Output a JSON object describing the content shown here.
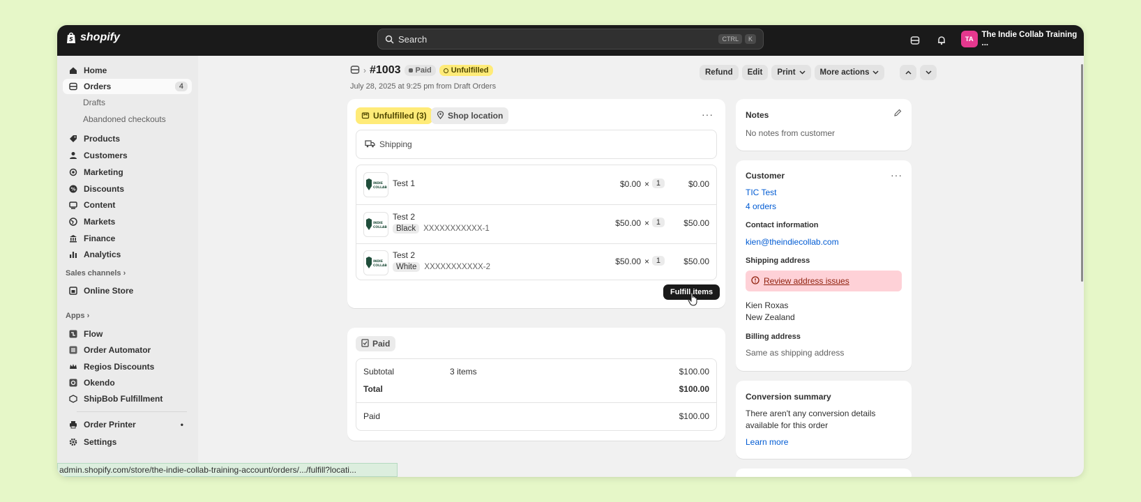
{
  "topbar": {
    "brand": "shopify",
    "search_placeholder": "Search",
    "shortcut_ctrl": "CTRL",
    "shortcut_k": "K",
    "avatar_initials": "TA",
    "store_name": "The Indie Collab Training ..."
  },
  "sidebar": {
    "home": "Home",
    "orders": "Orders",
    "orders_count": "4",
    "drafts": "Drafts",
    "abandoned": "Abandoned checkouts",
    "products": "Products",
    "customers": "Customers",
    "marketing": "Marketing",
    "discounts": "Discounts",
    "content": "Content",
    "markets": "Markets",
    "finance": "Finance",
    "analytics": "Analytics",
    "sales_channels": "Sales channels",
    "online_store": "Online Store",
    "apps": "Apps",
    "flow": "Flow",
    "order_automator": "Order Automator",
    "regios": "Regios Discounts",
    "okendo": "Okendo",
    "shipbob": "ShipBob Fulfillment",
    "order_printer": "Order Printer",
    "settings": "Settings"
  },
  "statusbar": {
    "url": "admin.shopify.com/store/the-indie-collab-training-account/orders/.../fulfill?locati..."
  },
  "order": {
    "number": "#1003",
    "payment_badge": "Paid",
    "fulfillment_badge": "Unfulfilled",
    "subtitle": "July 28, 2025 at 9:25 pm from Draft Orders",
    "actions": {
      "refund": "Refund",
      "edit": "Edit",
      "print": "Print",
      "more": "More actions"
    }
  },
  "fulfillment_card": {
    "status_chip": "Unfulfilled (3)",
    "location_chip": "Shop location",
    "shipping_label": "Shipping",
    "items": [
      {
        "name": "Test 1",
        "variant": "",
        "sku": "",
        "unit_price": "$0.00",
        "times": "×",
        "qty": "1",
        "total": "$0.00"
      },
      {
        "name": "Test 2",
        "variant": "Black",
        "sku": "XXXXXXXXXXX-1",
        "unit_price": "$50.00",
        "times": "×",
        "qty": "1",
        "total": "$50.00"
      },
      {
        "name": "Test 2",
        "variant": "White",
        "sku": "XXXXXXXXXXX-2",
        "unit_price": "$50.00",
        "times": "×",
        "qty": "1",
        "total": "$50.00"
      }
    ],
    "fulfill_button": "Fulfill items"
  },
  "payment_card": {
    "chip": "Paid",
    "subtotal_label": "Subtotal",
    "subtotal_items": "3 items",
    "subtotal_value": "$100.00",
    "total_label": "Total",
    "total_value": "$100.00",
    "paid_label": "Paid",
    "paid_value": "$100.00"
  },
  "notes_card": {
    "title": "Notes",
    "body": "No notes from customer"
  },
  "customer_card": {
    "title": "Customer",
    "name": "TIC Test",
    "orders": "4 orders",
    "contact_heading": "Contact information",
    "email": "kien@theindiecollab.com",
    "shipping_heading": "Shipping address",
    "review_issue": "Review address issues",
    "address_name": "Kien Roxas",
    "address_country": "New Zealand",
    "billing_heading": "Billing address",
    "billing_value": "Same as shipping address"
  },
  "conversion_card": {
    "title": "Conversion summary",
    "body_line1": "There aren't any conversion details",
    "body_line2": "available for this order",
    "link": "Learn more"
  },
  "colors": {
    "topbar": "#1a1a1a",
    "unfulfilled": "#ffeb78",
    "link": "#005bd3",
    "warning_bg": "#fed1d7",
    "avatar": "#e5388e",
    "page_bg": "#e6f7c8"
  }
}
